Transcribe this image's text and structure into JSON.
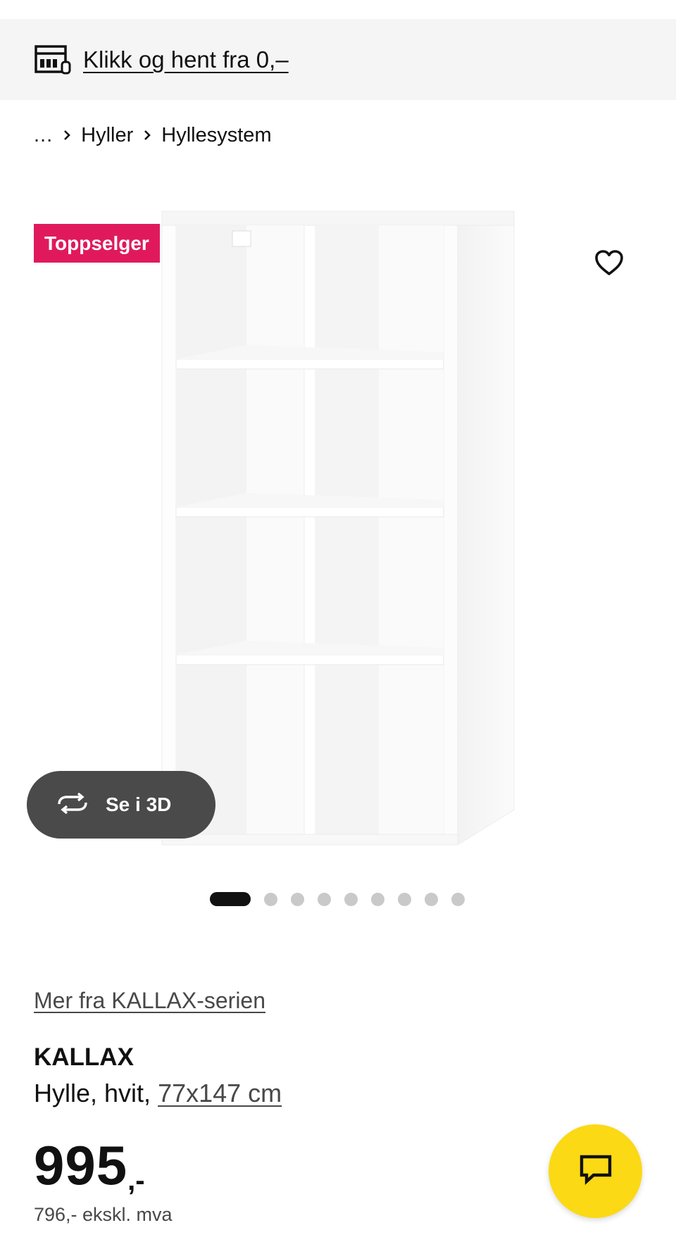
{
  "promo": {
    "icon": "store-icon",
    "text": "Klikk og hent fra 0,–"
  },
  "breadcrumb": {
    "ellipsis": "...",
    "items": [
      {
        "label": "Hyller"
      },
      {
        "label": "Hyllesystem"
      }
    ]
  },
  "badge": {
    "label": "Toppselger",
    "color": "#e0195d"
  },
  "gallery": {
    "view_3d_label": "Se i 3D",
    "dots": {
      "total": 9,
      "active_index": 0
    }
  },
  "product": {
    "series_link": "Mer fra KALLAX-serien",
    "name": "KALLAX",
    "description": "Hylle, hvit,",
    "size": "77x147 cm",
    "price_integer": "995",
    "price_suffix": ",-",
    "price_ex_vat": "796,- ekskl. mva"
  },
  "colors": {
    "accent_yellow": "#fbd914",
    "badge_pink": "#e0195d",
    "dark_button": "#4a4a4a"
  }
}
